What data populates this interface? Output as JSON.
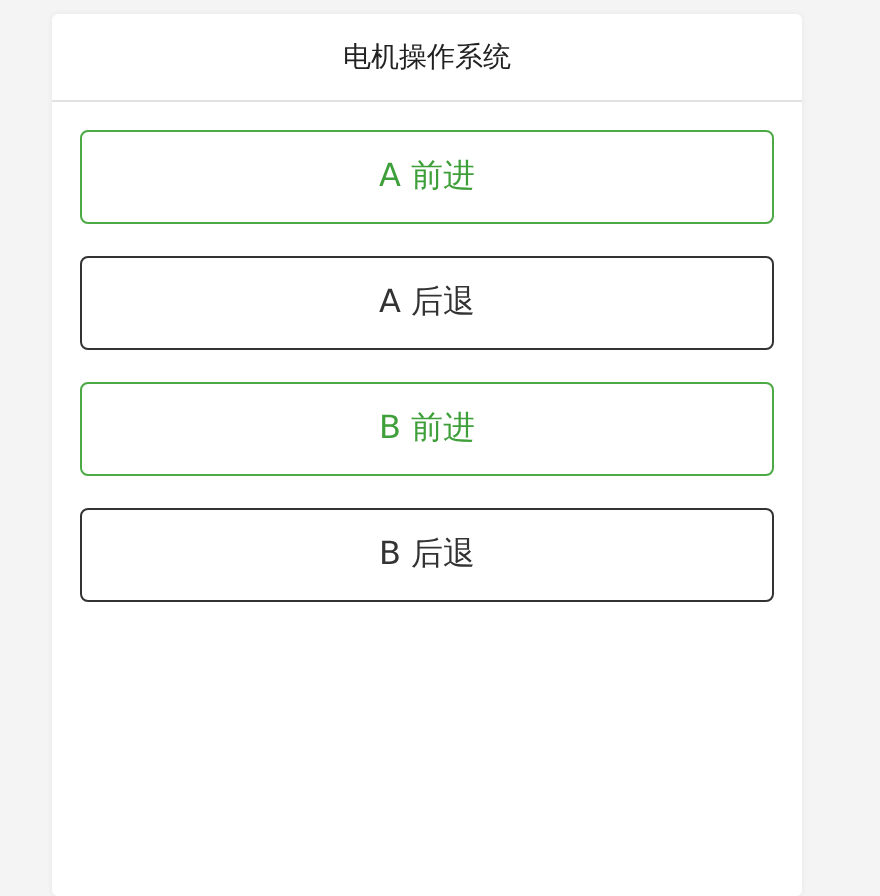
{
  "header": {
    "title": "电机操作系统"
  },
  "buttons": [
    {
      "label": "A 前进",
      "kind": "primary"
    },
    {
      "label": "A 后退",
      "kind": "default"
    },
    {
      "label": "B 前进",
      "kind": "primary"
    },
    {
      "label": "B 后退",
      "kind": "default"
    }
  ]
}
